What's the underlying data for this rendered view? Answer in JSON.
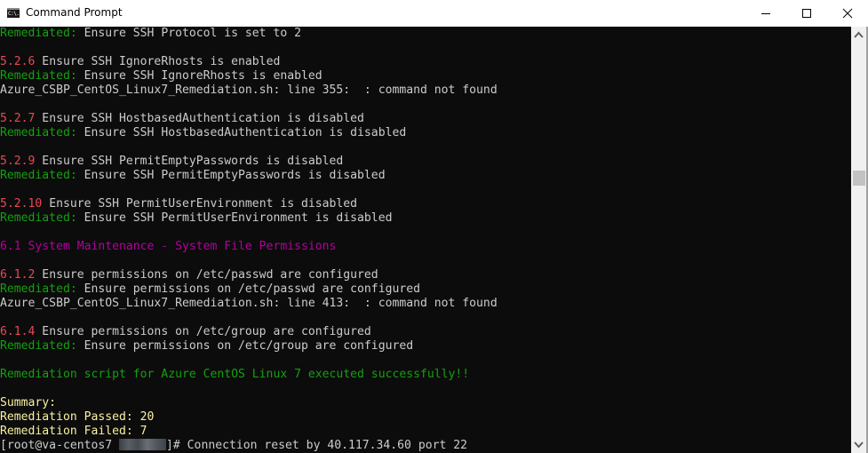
{
  "window": {
    "title": "Command Prompt",
    "icon": "console-icon",
    "icon_text": "C:\\.",
    "controls": [
      "minimize-icon",
      "maximize-icon",
      "close-icon"
    ]
  },
  "colors": {
    "background": "#0c0c0c",
    "default_text": "#cccccc",
    "remediated_green": "#13a10e",
    "section_red": "#e74856",
    "heading_magenta": "#b4009e",
    "summary_yellow": "#f9f1a5"
  },
  "console": {
    "lines": [
      {
        "prefix": "Remediated:",
        "text": " Ensure SSH Protocol is set to 2"
      },
      {
        "id": "5.2.6",
        "text": " Ensure SSH IgnoreRhosts is enabled"
      },
      {
        "prefix": "Remediated:",
        "text": " Ensure SSH IgnoreRhosts is enabled"
      },
      {
        "text": "Azure_CSBP_CentOS_Linux7_Remediation.sh: line 355:  : command not found"
      },
      {
        "id": "5.2.7",
        "text": " Ensure SSH HostbasedAuthentication is disabled"
      },
      {
        "prefix": "Remediated:",
        "text": " Ensure SSH HostbasedAuthentication is disabled"
      },
      {
        "id": "5.2.9",
        "text": " Ensure SSH PermitEmptyPasswords is disabled"
      },
      {
        "prefix": "Remediated:",
        "text": " Ensure SSH PermitEmptyPasswords is disabled"
      },
      {
        "id": "5.2.10",
        "text": " Ensure SSH PermitUserEnvironment is disabled"
      },
      {
        "prefix": "Remediated:",
        "text": " Ensure SSH PermitUserEnvironment is disabled"
      },
      {
        "heading": "6.1 System Maintenance - System File Permissions"
      },
      {
        "id": "6.1.2",
        "text": " Ensure permissions on /etc/passwd are configured"
      },
      {
        "prefix": "Remediated:",
        "text": " Ensure permissions on /etc/passwd are configured"
      },
      {
        "text": "Azure_CSBP_CentOS_Linux7_Remediation.sh: line 413:  : command not found"
      },
      {
        "id": "6.1.4",
        "text": " Ensure permissions on /etc/group are configured"
      },
      {
        "prefix": "Remediated:",
        "text": " Ensure permissions on /etc/group are configured"
      },
      {
        "success": "Remediation script for Azure CentOS Linux 7 executed successfully!!"
      },
      {
        "summary": "Summary:"
      },
      {
        "summary": "Remediation Passed: 20"
      },
      {
        "summary": "Remediation Failed: 7"
      }
    ],
    "prompt": {
      "user_host": "[root@va-centos7 ",
      "hidden_label": "redacted",
      "suffix": "]# ",
      "message": "Connection reset by 40.117.34.60 port 22"
    }
  },
  "summary": {
    "passed": 20,
    "failed": 7
  }
}
